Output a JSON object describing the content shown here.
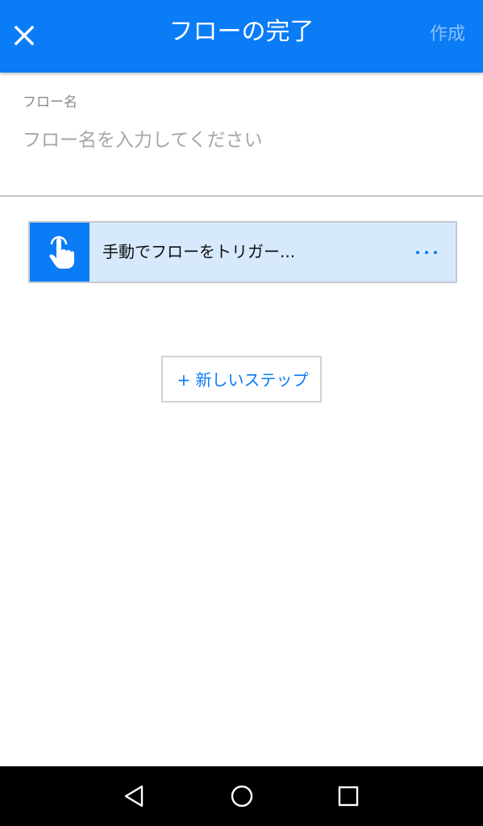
{
  "header": {
    "title": "フローの完了",
    "create_label": "作成",
    "close_icon": "close-icon",
    "background_color": "#0a7cf6"
  },
  "flow_name": {
    "label": "フロー名",
    "placeholder": "フロー名を入力してください",
    "value": ""
  },
  "trigger": {
    "label": "手動でフローをトリガー...",
    "icon": "touch-icon",
    "more_icon": "more-icon"
  },
  "new_step": {
    "label": "+ 新しいステップ"
  },
  "navbar": {
    "back_icon": "back-icon",
    "home_icon": "home-icon",
    "recents_icon": "recents-icon"
  }
}
